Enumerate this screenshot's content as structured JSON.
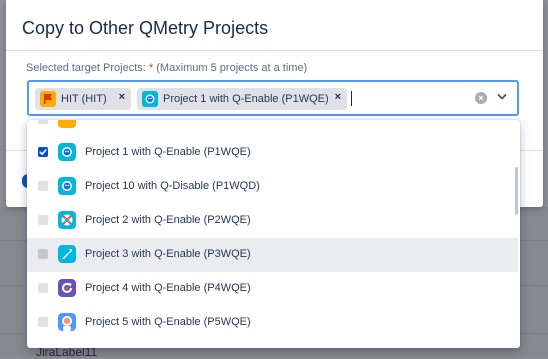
{
  "modal": {
    "title": "Copy to Other QMetry Projects",
    "field_label": "Selected target Projects: ",
    "required_mark": "*",
    "field_hint": " (Maximum 5 projects at a time)"
  },
  "selected_chips": [
    {
      "label": "HIT (HIT)",
      "icon": "flag-project-icon",
      "remove": "×"
    },
    {
      "label": "Project 1 with Q-Enable (P1WQE)",
      "icon": "robot-project-icon",
      "remove": "×"
    }
  ],
  "dropdown": {
    "options": [
      {
        "label": "Project 1 with Q-Enable (P1WQE)",
        "checked": true,
        "icon": "robot-project-icon"
      },
      {
        "label": "Project 10 with Q-Disable (P1WQD)",
        "checked": false,
        "icon": "robot-project-icon"
      },
      {
        "label": "Project 2 with Q-Enable (P2WQE)",
        "checked": false,
        "icon": "lifebuoy-project-icon"
      },
      {
        "label": "Project 3 with Q-Enable (P3WQE)",
        "checked": false,
        "icon": "rocket-project-icon",
        "hovered": true
      },
      {
        "label": "Project 4 with Q-Enable (P4WQE)",
        "checked": false,
        "icon": "refresh-project-icon"
      },
      {
        "label": "Project 5 with Q-Enable (P5WQE)",
        "checked": false,
        "icon": "astronaut-project-icon"
      }
    ]
  },
  "background": {
    "partial_text": "JiraLabel11"
  },
  "colors": {
    "accent": "#0052cc",
    "focus_border": "#4c9aff",
    "required": "#de350b",
    "overlay": "#8f9196"
  }
}
